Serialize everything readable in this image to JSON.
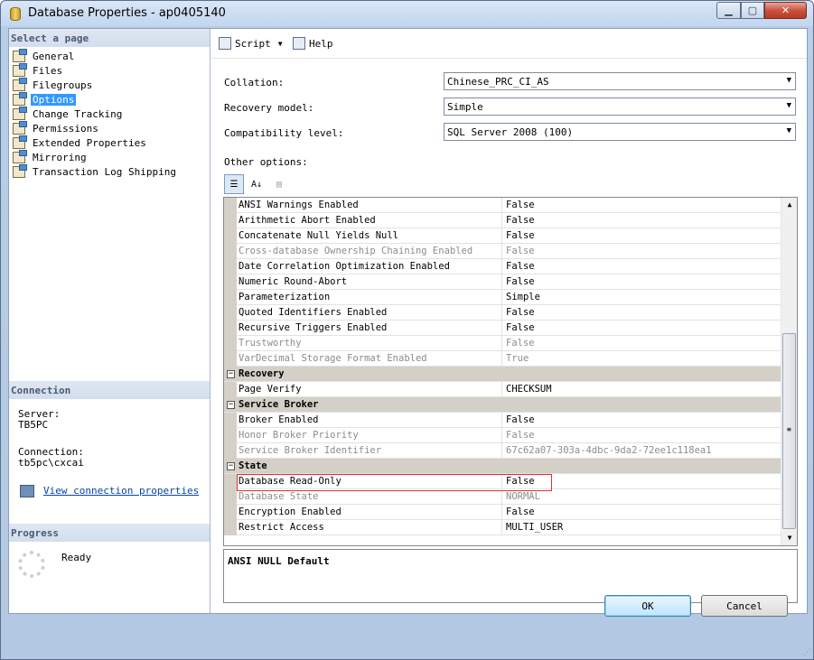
{
  "window": {
    "title": "Database Properties - ap0405140"
  },
  "left": {
    "select_page_header": "Select a page",
    "pages": [
      "General",
      "Files",
      "Filegroups",
      "Options",
      "Change Tracking",
      "Permissions",
      "Extended Properties",
      "Mirroring",
      "Transaction Log Shipping"
    ],
    "selected_page": "Options",
    "connection_header": "Connection",
    "server_label": "Server:",
    "server_value": "TB5PC",
    "connection_label": "Connection:",
    "connection_value": "tb5pc\\cxcai",
    "view_link": "View connection properties",
    "progress_header": "Progress",
    "progress_status": "Ready"
  },
  "toolbar": {
    "script_label": "Script",
    "help_label": "Help"
  },
  "form": {
    "collation_label": "Collation:",
    "collation_value": "Chinese_PRC_CI_AS",
    "recovery_label": "Recovery model:",
    "recovery_value": "Simple",
    "compat_label": "Compatibility level:",
    "compat_value": "SQL Server 2008 (100)",
    "other_label": "Other options:"
  },
  "grid": {
    "rows": [
      {
        "name": "ANSI Warnings Enabled",
        "value": "False",
        "readonly": false
      },
      {
        "name": "Arithmetic Abort Enabled",
        "value": "False",
        "readonly": false
      },
      {
        "name": "Concatenate Null Yields Null",
        "value": "False",
        "readonly": false
      },
      {
        "name": "Cross-database Ownership Chaining Enabled",
        "value": "False",
        "readonly": true
      },
      {
        "name": "Date Correlation Optimization Enabled",
        "value": "False",
        "readonly": false
      },
      {
        "name": "Numeric Round-Abort",
        "value": "False",
        "readonly": false
      },
      {
        "name": "Parameterization",
        "value": "Simple",
        "readonly": false
      },
      {
        "name": "Quoted Identifiers Enabled",
        "value": "False",
        "readonly": false
      },
      {
        "name": "Recursive Triggers Enabled",
        "value": "False",
        "readonly": false
      },
      {
        "name": "Trustworthy",
        "value": "False",
        "readonly": true
      },
      {
        "name": "VarDecimal Storage Format Enabled",
        "value": "True",
        "readonly": true
      },
      {
        "category": "Recovery"
      },
      {
        "name": "Page Verify",
        "value": "CHECKSUM",
        "readonly": false
      },
      {
        "category": "Service Broker"
      },
      {
        "name": "Broker Enabled",
        "value": "False",
        "readonly": false
      },
      {
        "name": "Honor Broker Priority",
        "value": "False",
        "readonly": true
      },
      {
        "name": "Service Broker Identifier",
        "value": "67c62a07-303a-4dbc-9da2-72ee1c118ea1",
        "readonly": true
      },
      {
        "category": "State"
      },
      {
        "name": "Database Read-Only",
        "value": "False",
        "readonly": false
      },
      {
        "name": "Database State",
        "value": "NORMAL",
        "readonly": true
      },
      {
        "name": "Encryption Enabled",
        "value": "False",
        "readonly": false
      },
      {
        "name": "Restrict Access",
        "value": "MULTI_USER",
        "readonly": false
      }
    ],
    "description": "ANSI NULL Default"
  },
  "buttons": {
    "ok": "OK",
    "cancel": "Cancel"
  }
}
